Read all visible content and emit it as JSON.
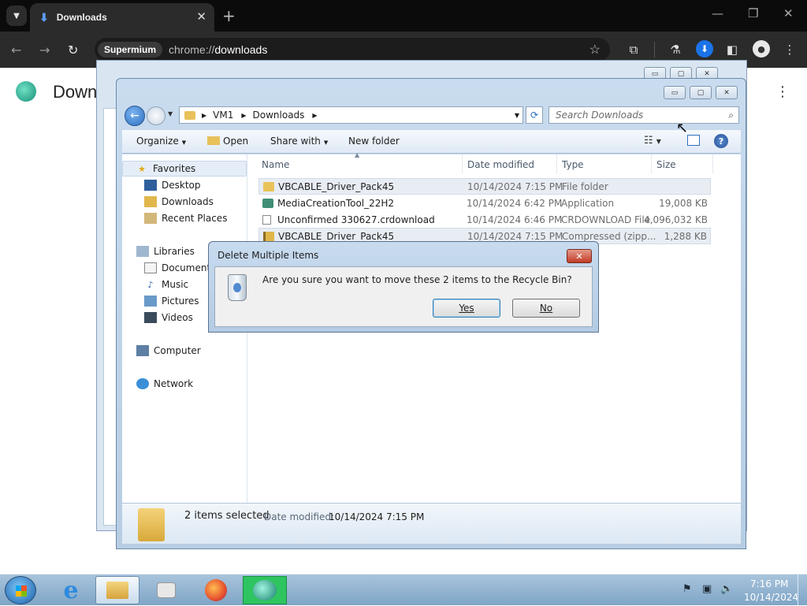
{
  "chrome": {
    "tab_title": "Downloads",
    "omnibox_chip": "Supermium",
    "url_scheme": "chrome://",
    "url_host": "downloads"
  },
  "page": {
    "title": "Downl"
  },
  "explorer": {
    "breadcrumb": [
      "VM1",
      "Downloads"
    ],
    "search_placeholder": "Search Downloads",
    "commands": {
      "organize": "Organize",
      "open": "Open",
      "share_with": "Share with",
      "new_folder": "New folder"
    },
    "nav": {
      "favorites": "Favorites",
      "desktop": "Desktop",
      "downloads": "Downloads",
      "recent_places": "Recent Places",
      "libraries": "Libraries",
      "documents": "Documents",
      "music": "Music",
      "pictures": "Pictures",
      "videos": "Videos",
      "computer": "Computer",
      "network": "Network"
    },
    "columns": {
      "name": "Name",
      "date": "Date modified",
      "type": "Type",
      "size": "Size"
    },
    "files": [
      {
        "name": "VBCABLE_Driver_Pack45",
        "date": "10/14/2024 7:15 PM",
        "type": "File folder",
        "size": "",
        "icon": "folder-icon",
        "selected": true
      },
      {
        "name": "MediaCreationTool_22H2",
        "date": "10/14/2024 6:42 PM",
        "type": "Application",
        "size": "19,008 KB",
        "icon": "application-icon",
        "selected": false
      },
      {
        "name": "Unconfirmed 330627.crdownload",
        "date": "10/14/2024 6:46 PM",
        "type": "CRDOWNLOAD File",
        "size": "4,096,032 KB",
        "icon": "file-icon",
        "selected": false
      },
      {
        "name": "VBCABLE_Driver_Pack45",
        "date": "10/14/2024 7:15 PM",
        "type": "Compressed (zipp...",
        "size": "1,288 KB",
        "icon": "zip-icon",
        "selected": true
      }
    ],
    "details": {
      "count": "2 items selected",
      "date_label": "Date modified:",
      "date_value": "10/14/2024 7:15 PM"
    }
  },
  "dialog": {
    "title": "Delete Multiple Items",
    "message": "Are you sure you want to move these 2 items to the Recycle Bin?",
    "yes": "Yes",
    "no": "No"
  },
  "taskbar": {
    "time": "7:16 PM",
    "date": "10/14/2024"
  }
}
